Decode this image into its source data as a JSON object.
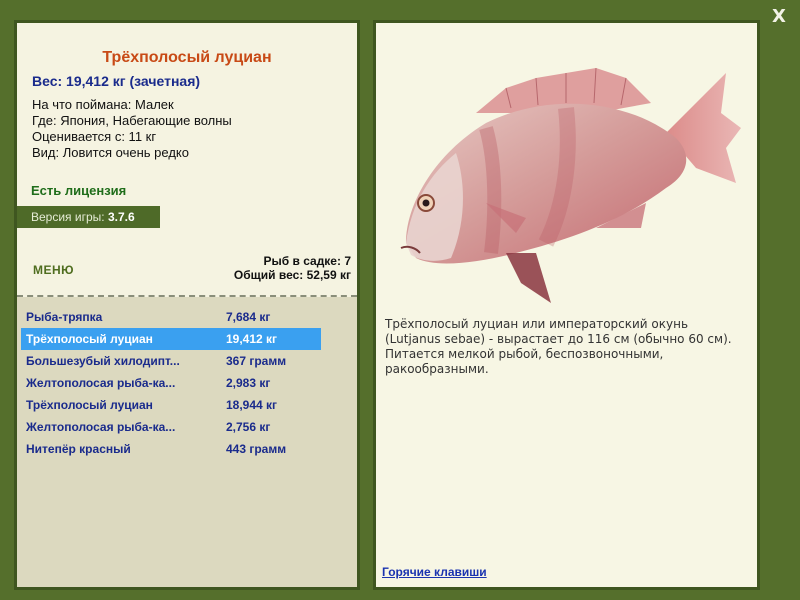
{
  "window": {
    "close_label": "X"
  },
  "fish": {
    "title": "Трёхполосый луциан",
    "weight": "Вес: 19,412 кг (зачетная)",
    "info": [
      "На что поймана: Малек",
      "Где: Япония, Набегающие волны",
      "Оценивается с: 11 кг",
      "Вид: Ловится очень редко"
    ],
    "license": "Есть лицензия",
    "version_label": "Версия игры: ",
    "version_value": "3.7.6"
  },
  "menu": {
    "label": "МЕНЮ"
  },
  "cage": {
    "count": "Рыб в садке: 7",
    "total": "Общий вес: 52,59 кг"
  },
  "catch_list": [
    {
      "name": "Рыба-тряпка",
      "weight": "7,684 кг",
      "selected": false
    },
    {
      "name": "Трёхполосый луциан",
      "weight": "19,412 кг",
      "selected": true
    },
    {
      "name": "Большезубый хилодипт...",
      "weight": "367 грамм",
      "selected": false
    },
    {
      "name": "Желтополосая рыба-ка...",
      "weight": "2,983 кг",
      "selected": false
    },
    {
      "name": "Трёхполосый луциан",
      "weight": "18,944 кг",
      "selected": false
    },
    {
      "name": "Желтополосая рыба-ка...",
      "weight": "2,756 кг",
      "selected": false
    },
    {
      "name": "Нитепёр красный",
      "weight": "443 грамм",
      "selected": false
    }
  ],
  "description": "Трёхполосый луциан или императорский окунь (Lutjanus sebae) - вырастает до 116 см (обычно 60 см). Питается мелкой рыбой, беспозвоночными, ракообразными.",
  "hotkeys_label": "Горячие клавиши",
  "colors": {
    "frame": "#556f2c",
    "title": "#c84a16",
    "list_text": "#1a2b8c",
    "selected_row": "#3aa0f0",
    "license": "#1f6d1a"
  }
}
